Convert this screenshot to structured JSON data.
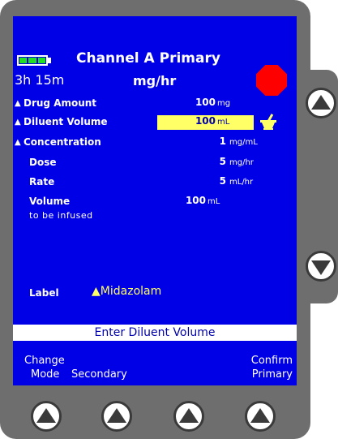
{
  "header": {
    "battery_icon": "battery-full-icon",
    "title": "Channel A Primary",
    "time_remaining": "3h 15m",
    "units": "mg/hr",
    "stop_icon": "stop-sign-icon",
    "stop_color": "#ff0000"
  },
  "rows": [
    {
      "marker": "▲",
      "label": "Drug Amount",
      "value": "100",
      "unit": "mg"
    },
    {
      "marker": "▲",
      "label": "Diluent Volume",
      "value": "100",
      "unit": "mL"
    },
    {
      "marker": "▲",
      "label": "Concentration",
      "value": "1",
      "unit": "mg/mL"
    },
    {
      "marker": "",
      "label": "Dose",
      "value": "5",
      "unit": "mg/hr"
    },
    {
      "marker": "",
      "label": "Rate",
      "value": "5",
      "unit": "mL/hr"
    },
    {
      "marker": "",
      "label": "Volume",
      "value": "100",
      "unit": "mL"
    }
  ],
  "volume_subtext": "to be infused",
  "selected_row_icon": "mortar-pestle-icon",
  "drug_label": {
    "title": "Label",
    "marker": "▲",
    "value": "Midazolam"
  },
  "prompt": "Enter Diluent Volume",
  "softkeys": {
    "left_line1": "Change",
    "left_line2": "Mode",
    "middle": "Secondary",
    "right_line1": "Confirm",
    "right_line2": "Primary"
  },
  "colors": {
    "screen": "#0000e6",
    "highlight": "#ffff66",
    "label_value": "#ffff66",
    "device": "#6e6e6e"
  }
}
